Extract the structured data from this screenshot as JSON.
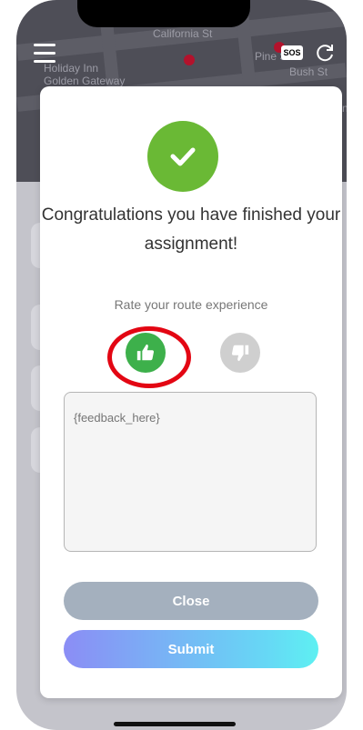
{
  "map": {
    "labels": [
      "California St",
      "Pine St",
      "Bush St",
      "Holiday Inn",
      "Golden Gateway",
      "Fran"
    ],
    "sos_label": "SOS"
  },
  "modal": {
    "title": "Congratulations you have finished your assignment!",
    "rate_label": "Rate your route experience",
    "feedback_placeholder": "{feedback_here}",
    "close_label": "Close",
    "submit_label": "Submit",
    "thumb_up_selected": true
  },
  "colors": {
    "success_green": "#6ab935",
    "thumb_up_green": "#3db04b",
    "highlight_red": "#e30613",
    "close_button": "#a4b0be",
    "submit_gradient_start": "#8b8df5",
    "submit_gradient_end": "#5ef0f2"
  }
}
